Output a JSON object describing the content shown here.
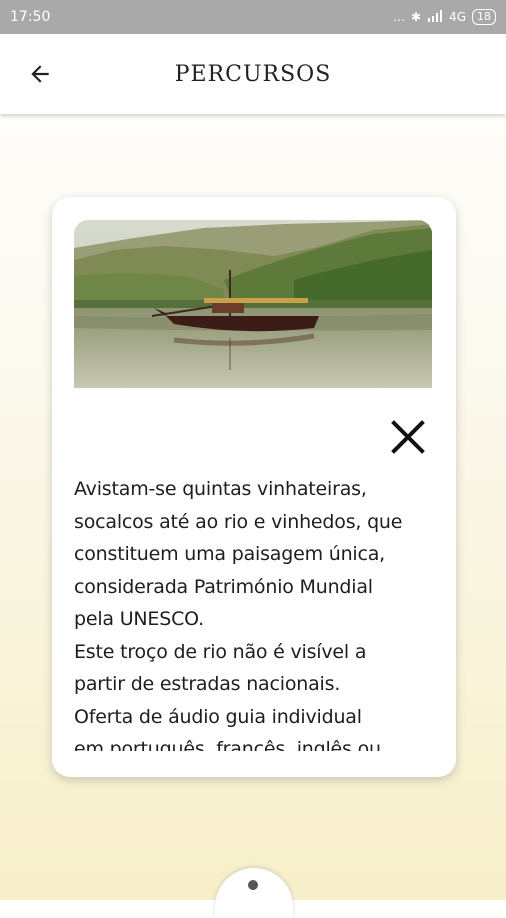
{
  "status_bar": {
    "time": "17:50",
    "network": "4G",
    "battery": "18"
  },
  "header": {
    "title": "PERCURSOS"
  },
  "card": {
    "description": "Avistam-se quintas vinhateiras,\nsocalcos até ao rio e vinhedos, que\nconstituem uma paisagem única,\nconsiderada Património Mundial\npela UNESCO.\n Este troço de rio não é visível a\npartir de estradas nacionais.\n Oferta de áudio guia individual\nem português, francês, inglês ou"
  },
  "icons": {
    "back": "arrow-left-icon",
    "close": "close-icon"
  },
  "colors": {
    "status_bar": "#a9a9a9",
    "background_bottom": "#f7efc9"
  }
}
